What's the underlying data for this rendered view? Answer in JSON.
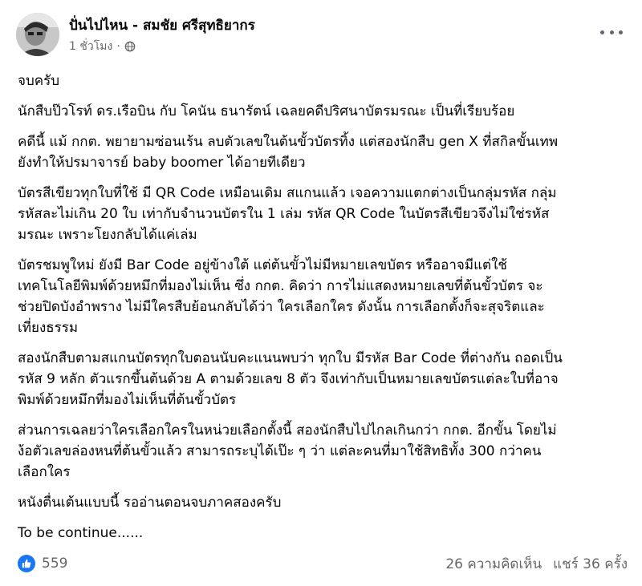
{
  "post": {
    "author": "ปั่นไปไหน - สมชัย ศรีสุทธิยากร",
    "time": "1 ชั่วโมง",
    "separator": "·",
    "paragraphs": [
      "จบครับ",
      "นักสืบป๊วโรท์ ดร.เรือบิน กับ โคนัน ธนารัตน์ เฉลยคดีปริศนาบัตรมรณะ เป็นที่เรียบร้อย",
      "คดีนี้ แม้ กกต. พยายามซ่อนเร้น ลบตัวเลขในต้นขั้วบัตรทิ้ง แต่สองนักสืบ gen X ที่สกิลขั้นเทพ\nยังทำให้ปรมาจารย์ baby boomer ได้อายทีเดียว",
      "บัตรสีเขียวทุกใบที่ใช้ มี QR Code เหมือนเดิม สแกนแล้ว เจอความแตกต่างเป็นกลุ่มรหัส  กลุ่ม\nรหัสละไม่เกิน 20 ใบ  เท่ากับจำนวนบัตรใน 1 เล่ม  รหัส QR Code ในบัตรสีเขียวจึงไม่ใช่รหัส\nมรณะ เพราะโยงกลับได้แค่เล่ม",
      "บัตรชมพูใหม่ ยังมี Bar Code อยู่ข้างใต้ แต่ต้นขั้วไม่มีหมายเลขบัตร  หรืออาจมีแต่ใช้\nเทคโนโลยีพิมพ์ด้วยหมึกที่มองไม่เห็น  ซึ่ง กกต. คิดว่า การไม่แสดงหมายเลขที่ต้นขั้วบัตร จะ\nช่วยปิดบังอำพราง ไม่มีใครสืบย้อนกลับได้ว่า ใครเลือกใคร  ดังนั้น การเลือกตั้งก็จะสุจริตและ\nเที่ยงธรรม",
      "สองนักสืบตามสแกนบัตรทุกใบตอนนับคะแนนพบว่า ทุกใบ  มีรหัส Bar Code ที่ต่างกัน ถอดเป็น\nรหัส 9 หลัก ตัวแรกขึ้นต้นด้วย A ตามด้วยเลข 8 ตัว  จึงเท่ากับเป็นหมายเลขบัตรแต่ละใบที่อาจ\nพิมพ์ด้วยหมึกที่มองไม่เห็นที่ต้นขั้วบัตร",
      "ส่วนการเฉลยว่าใครเลือกใครในหน่วยเลือกตั้งนี้ สองนักสืบไปไกลเกินกว่า กกต. อีกขั้น โดยไม่\nง้อตัวเลขล่องหนที่ต้นขั้วแล้ว สามารถระบุได้เป๊ะ ๆ ว่า แต่ละคนที่มาใช้สิทธิทั้ง 300 กว่าคน\nเลือกใคร",
      "หนังตื่นเต้นแบบนี้  รออ่านตอนจบภาคสองครับ",
      "To be continue......"
    ],
    "reactions": "559",
    "comments": "26 ความคิดเห็น",
    "shares": "แชร์ 36 ครั้ง"
  },
  "icons": {
    "audience": "globe-icon",
    "more": "more-options-icon",
    "reaction": "like-icon"
  },
  "colors": {
    "like_blue": "#1877f2",
    "meta_gray": "#65676b"
  }
}
